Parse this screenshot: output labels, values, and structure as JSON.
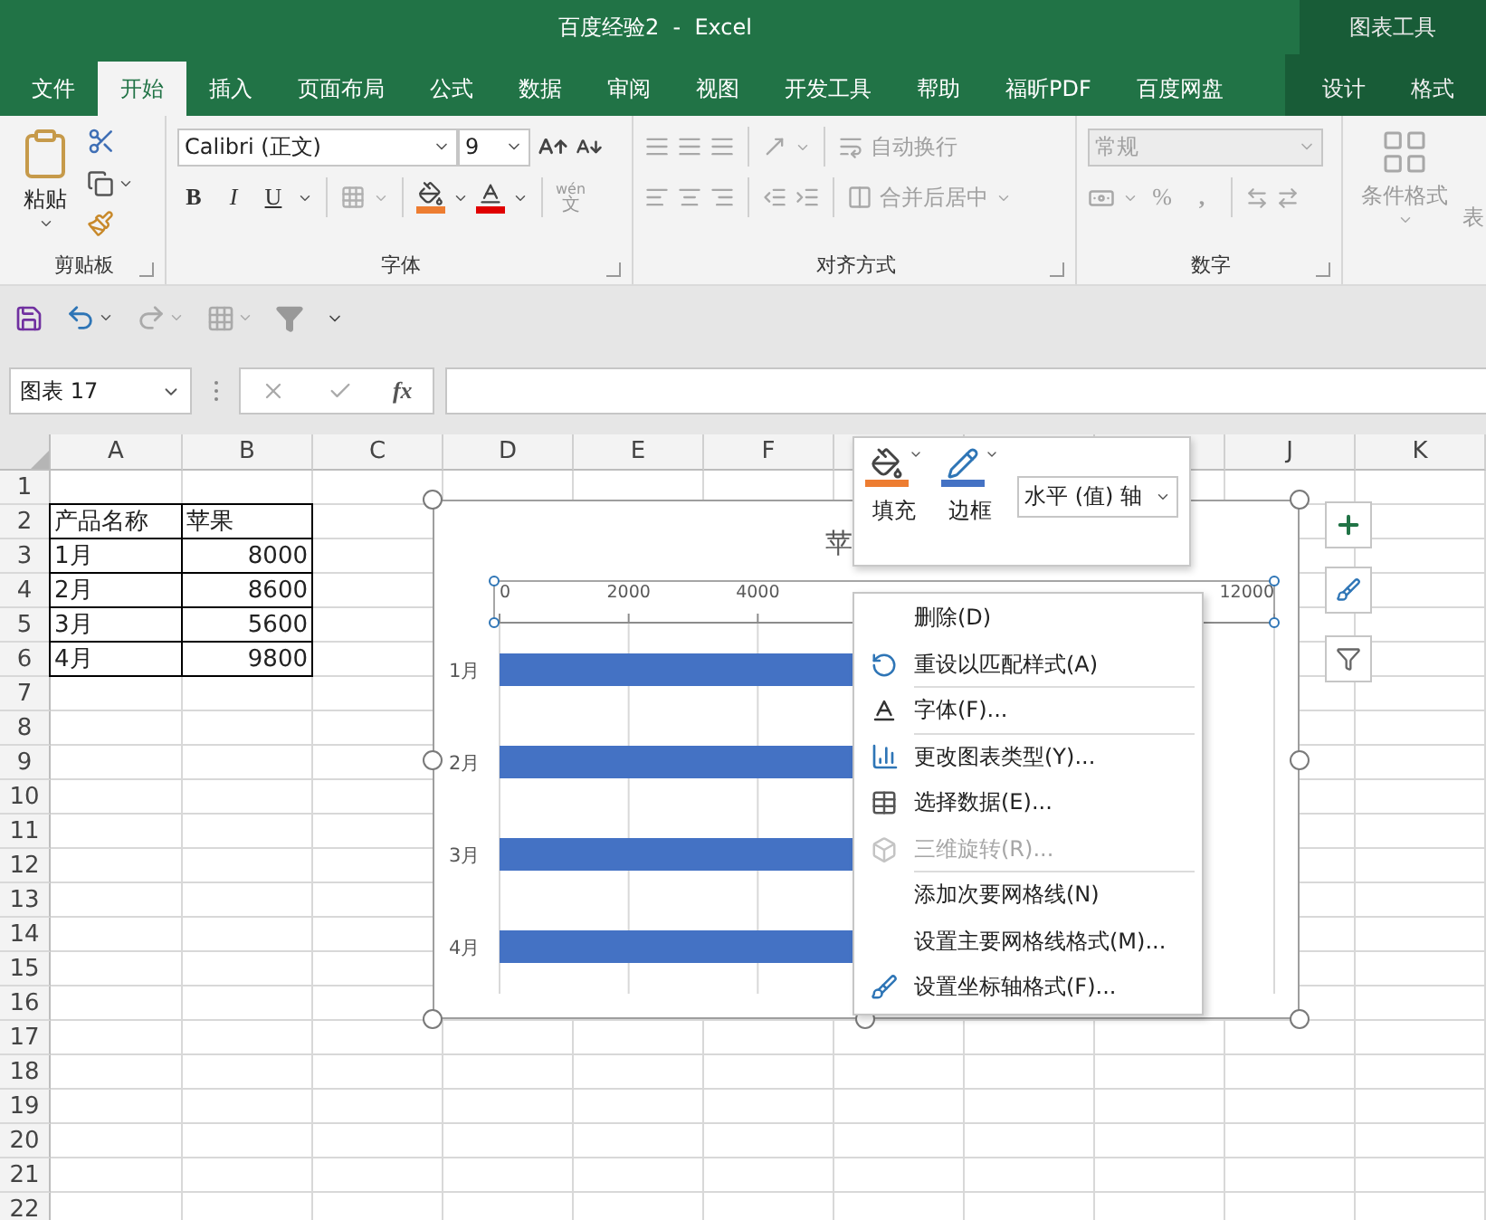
{
  "window": {
    "title": "百度经验2  -  Excel",
    "context_group": "图表工具"
  },
  "ribbon_tabs": [
    {
      "label": "文件",
      "selected": false,
      "contextual": false
    },
    {
      "label": "开始",
      "selected": true,
      "contextual": false
    },
    {
      "label": "插入",
      "selected": false,
      "contextual": false
    },
    {
      "label": "页面布局",
      "selected": false,
      "contextual": false
    },
    {
      "label": "公式",
      "selected": false,
      "contextual": false
    },
    {
      "label": "数据",
      "selected": false,
      "contextual": false
    },
    {
      "label": "审阅",
      "selected": false,
      "contextual": false
    },
    {
      "label": "视图",
      "selected": false,
      "contextual": false
    },
    {
      "label": "开发工具",
      "selected": false,
      "contextual": false
    },
    {
      "label": "帮助",
      "selected": false,
      "contextual": false
    },
    {
      "label": "福昕PDF",
      "selected": false,
      "contextual": false
    },
    {
      "label": "百度网盘",
      "selected": false,
      "contextual": false
    },
    {
      "label": "设计",
      "selected": false,
      "contextual": true
    },
    {
      "label": "格式",
      "selected": false,
      "contextual": true
    }
  ],
  "ribbon": {
    "clipboard": {
      "paste": "粘贴",
      "group": "剪贴板"
    },
    "font": {
      "font_name": "Calibri (正文)",
      "font_size": "9",
      "bold": "B",
      "italic": "I",
      "underline": "U",
      "phonetic_top": "wén",
      "phonetic_bottom": "文",
      "group": "字体"
    },
    "alignment": {
      "wrap": "自动换行",
      "merge": "合并后居中",
      "group": "对齐方式",
      "disabled": true
    },
    "number": {
      "format": "常规",
      "percent": "%",
      "comma": ",",
      "group": "数字",
      "disabled": true
    },
    "styles": {
      "conditional": "条件格式",
      "cut_label": "表",
      "disabled": true
    }
  },
  "formula_bar": {
    "name_box": "图表 17",
    "fx": "fx"
  },
  "columns": [
    {
      "label": "A"
    },
    {
      "label": "B"
    },
    {
      "label": "C"
    },
    {
      "label": "D"
    },
    {
      "label": "E"
    },
    {
      "label": "F"
    },
    {},
    {},
    {},
    {
      "label": "J"
    },
    {
      "label": "K"
    }
  ],
  "row_headers": [
    "1",
    "2",
    "3",
    "4",
    "5",
    "6",
    "7",
    "8",
    "9",
    "10",
    "11",
    "12",
    "13",
    "14",
    "15",
    "16",
    "17",
    "18",
    "19",
    "20",
    "21",
    "22"
  ],
  "data_table": [
    [
      "产品名称",
      "苹果"
    ],
    [
      "1月",
      "8000"
    ],
    [
      "2月",
      "8600"
    ],
    [
      "3月",
      "5600"
    ],
    [
      "4月",
      "9800"
    ]
  ],
  "chart": {
    "title_visible": "苹",
    "tick_labels": [
      "0",
      "2000",
      "4000"
    ],
    "end_tick_label": "12000",
    "categories": [
      "1月",
      "2月",
      "3月",
      "4月"
    ]
  },
  "format_popup": {
    "fill": "填充",
    "border": "边框",
    "element": "水平 (值) 轴"
  },
  "context_menu": [
    {
      "label": "删除(D)",
      "kind": "plain",
      "disabled": false,
      "separator_after": false
    },
    {
      "label": "重设以匹配样式(A)",
      "kind": "reset",
      "disabled": false,
      "separator_after": true
    },
    {
      "label": "字体(F)...",
      "kind": "font",
      "disabled": false,
      "separator_after": true
    },
    {
      "label": "更改图表类型(Y)...",
      "kind": "chart",
      "disabled": false,
      "separator_after": false
    },
    {
      "label": "选择数据(E)...",
      "kind": "data",
      "disabled": false,
      "separator_after": false
    },
    {
      "label": "三维旋转(R)...",
      "kind": "rotation",
      "disabled": true,
      "separator_after": true
    },
    {
      "label": "添加次要网格线(N)",
      "kind": "plain",
      "disabled": false,
      "separator_after": false
    },
    {
      "label": "设置主要网格线格式(M)...",
      "kind": "plain",
      "disabled": false,
      "separator_after": false
    },
    {
      "label": "设置坐标轴格式(F)...",
      "kind": "axis",
      "disabled": false,
      "separator_after": false
    }
  ]
}
